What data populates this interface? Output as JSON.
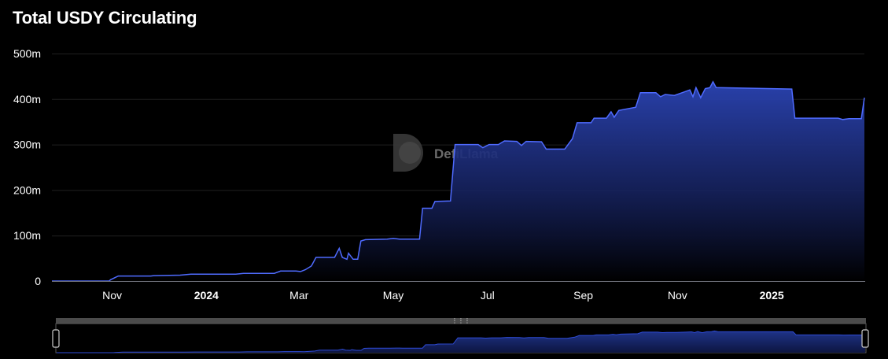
{
  "chart_data": {
    "type": "area",
    "title": "Total USDY Circulating",
    "xlabel": "",
    "ylabel": "",
    "ylim": [
      0,
      500
    ],
    "y_unit": "m",
    "y_ticks": [
      {
        "value": 0,
        "label": "0"
      },
      {
        "value": 100,
        "label": "100m"
      },
      {
        "value": 200,
        "label": "200m"
      },
      {
        "value": 300,
        "label": "300m"
      },
      {
        "value": 400,
        "label": "400m"
      },
      {
        "value": 500,
        "label": "500m"
      }
    ],
    "xlim": [
      "2023-09-23",
      "2025-03-02"
    ],
    "x_ticks": [
      {
        "date": "2023-11-01",
        "label": "Nov",
        "bold": false
      },
      {
        "date": "2024-01-01",
        "label": "2024",
        "bold": true
      },
      {
        "date": "2024-03-01",
        "label": "Mar",
        "bold": false
      },
      {
        "date": "2024-05-01",
        "label": "May",
        "bold": false
      },
      {
        "date": "2024-07-01",
        "label": "Jul",
        "bold": false
      },
      {
        "date": "2024-09-01",
        "label": "Sep",
        "bold": false
      },
      {
        "date": "2024-11-01",
        "label": "Nov",
        "bold": false
      },
      {
        "date": "2025-01-01",
        "label": "2025",
        "bold": true
      }
    ],
    "grid": true,
    "colors": {
      "line": "#4f6bff",
      "fill_top": "#2a3fa8",
      "fill_bottom": "#000000",
      "grid": "#1f1f1f"
    },
    "series": [
      {
        "points": [
          [
            "2023-09-23",
            0
          ],
          [
            "2023-10-30",
            0
          ],
          [
            "2023-10-31",
            3
          ],
          [
            "2023-11-05",
            11
          ],
          [
            "2023-11-26",
            11
          ],
          [
            "2023-11-28",
            12
          ],
          [
            "2023-12-15",
            13
          ],
          [
            "2023-12-22",
            15
          ],
          [
            "2024-01-20",
            15
          ],
          [
            "2024-01-25",
            17
          ],
          [
            "2024-02-14",
            17
          ],
          [
            "2024-02-18",
            22
          ],
          [
            "2024-02-28",
            22
          ],
          [
            "2024-03-02",
            21
          ],
          [
            "2024-03-05",
            25
          ],
          [
            "2024-03-09",
            33
          ],
          [
            "2024-03-12",
            52
          ],
          [
            "2024-03-24",
            52
          ],
          [
            "2024-03-27",
            72
          ],
          [
            "2024-03-29",
            52
          ],
          [
            "2024-04-01",
            48
          ],
          [
            "2024-04-02",
            61
          ],
          [
            "2024-04-05",
            48
          ],
          [
            "2024-04-08",
            48
          ],
          [
            "2024-04-10",
            88
          ],
          [
            "2024-04-13",
            91
          ],
          [
            "2024-04-27",
            92
          ],
          [
            "2024-05-01",
            94
          ],
          [
            "2024-05-05",
            92
          ],
          [
            "2024-05-18",
            92
          ],
          [
            "2024-05-20",
            160
          ],
          [
            "2024-05-26",
            160
          ],
          [
            "2024-05-28",
            175
          ],
          [
            "2024-06-07",
            176
          ],
          [
            "2024-06-10",
            300
          ],
          [
            "2024-06-25",
            300
          ],
          [
            "2024-06-28",
            293
          ],
          [
            "2024-07-02",
            300
          ],
          [
            "2024-07-08",
            300
          ],
          [
            "2024-07-12",
            308
          ],
          [
            "2024-07-20",
            307
          ],
          [
            "2024-07-23",
            298
          ],
          [
            "2024-07-26",
            307
          ],
          [
            "2024-08-05",
            306
          ],
          [
            "2024-08-08",
            290
          ],
          [
            "2024-08-20",
            290
          ],
          [
            "2024-08-25",
            313
          ],
          [
            "2024-08-28",
            348
          ],
          [
            "2024-09-06",
            348
          ],
          [
            "2024-09-08",
            358
          ],
          [
            "2024-09-16",
            358
          ],
          [
            "2024-09-19",
            372
          ],
          [
            "2024-09-21",
            360
          ],
          [
            "2024-09-24",
            375
          ],
          [
            "2024-10-05",
            382
          ],
          [
            "2024-10-08",
            414
          ],
          [
            "2024-10-18",
            414
          ],
          [
            "2024-10-21",
            405
          ],
          [
            "2024-10-24",
            410
          ],
          [
            "2024-10-30",
            408
          ],
          [
            "2024-11-05",
            415
          ],
          [
            "2024-11-09",
            420
          ],
          [
            "2024-11-11",
            405
          ],
          [
            "2024-11-13",
            425
          ],
          [
            "2024-11-16",
            403
          ],
          [
            "2024-11-19",
            423
          ],
          [
            "2024-11-22",
            425
          ],
          [
            "2024-11-24",
            438
          ],
          [
            "2024-11-26",
            425
          ],
          [
            "2025-01-14",
            422
          ],
          [
            "2025-01-16",
            358
          ],
          [
            "2025-02-13",
            358
          ],
          [
            "2025-02-16",
            355
          ],
          [
            "2025-02-20",
            357
          ],
          [
            "2025-02-28",
            357
          ],
          [
            "2025-03-02",
            403
          ]
        ]
      }
    ],
    "watermark": {
      "text": "DefiLlama"
    }
  }
}
